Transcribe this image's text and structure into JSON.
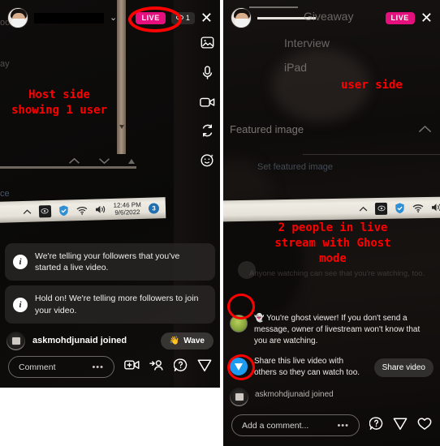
{
  "host_panel": {
    "name": "host-side-live-broadcast",
    "header": {
      "username_redacted": "",
      "chevron_icon": "chevron-down-icon",
      "live_label": "LIVE",
      "viewer_count": "1",
      "eye_icon": "eye-icon",
      "close_icon": "close-icon"
    },
    "rail": [
      {
        "icon": "image-icon"
      },
      {
        "icon": "microphone-icon"
      },
      {
        "icon": "video-camera-icon"
      },
      {
        "icon": "flip-camera-icon"
      },
      {
        "icon": "effects-smiley-icon"
      }
    ],
    "background_text": {
      "line1": "oo",
      "line2": "ay",
      "line3": "ce"
    },
    "taskbar": {
      "chevron_up_icon": "chevron-up-icon",
      "hidden_icons_icon": "tray-app-icon",
      "security_icon": "windows-security-icon",
      "wifi_icon": "wifi-icon",
      "volume_icon": "speaker-icon",
      "time": "12:46 PM",
      "date": "9/6/2022",
      "notification_count": "3"
    },
    "toasts": [
      {
        "icon": "info-icon",
        "text": "We're telling your followers that you've started a live video."
      },
      {
        "icon": "info-icon",
        "text": "Hold on! We're telling more followers to join your video."
      }
    ],
    "join_event": {
      "avatar_icon": "user-avatar",
      "text": "askmohdjunaid joined",
      "wave_emoji": "👋",
      "wave_label": "Wave"
    },
    "comment_bar": {
      "placeholder": "Comment",
      "more_icon": "ellipsis-icon",
      "icons": [
        {
          "icon": "add-video-icon"
        },
        {
          "icon": "invite-person-icon"
        },
        {
          "icon": "question-icon"
        },
        {
          "icon": "send-icon"
        }
      ]
    },
    "annotation": {
      "line1": "Host side",
      "line2": "showing 1 user"
    }
  },
  "user_panel": {
    "name": "viewer-side-live-broadcast",
    "header": {
      "username_redacted": "",
      "check_icon": "check-icon",
      "live_label": "LIVE",
      "close_icon": "close-icon"
    },
    "background_text": {
      "item1": "Giveaway",
      "item2": "Interview",
      "item3": "iPad",
      "featured_image": "Featured image",
      "featured_chevron_icon": "chevron-up-icon",
      "set_featured_image": "Set featured image",
      "faint_comment": "Anyone watching can see that you're watching, too."
    },
    "taskbar": {
      "chevron_up_icon": "chevron-up-icon",
      "hidden_icons_icon": "tray-app-icon",
      "security_icon": "windows-security-icon",
      "wifi_icon": "wifi-icon",
      "volume_icon": "speaker-icon"
    },
    "messages": [
      {
        "avatar_icon": "ghost-viewer-avatar",
        "emoji": "👻",
        "text": "You're ghost viewer! If you don't send a message, owner of livestream won't know that you are watching.",
        "circled": true
      },
      {
        "avatar_icon": "share-send-icon",
        "text": "Share this live video with others so they can watch too.",
        "button": "Share video",
        "circled": false
      },
      {
        "avatar_icon": "user-avatar",
        "text": "askmohdjunaid joined",
        "circled": true
      }
    ],
    "comment_bar": {
      "placeholder": "Add a comment...",
      "more_icon": "ellipsis-icon",
      "icons": [
        {
          "icon": "question-icon"
        },
        {
          "icon": "send-icon"
        },
        {
          "icon": "heart-icon"
        }
      ]
    },
    "annotation": {
      "label": "user side",
      "line1": "2 people in live",
      "line2": "stream with Ghost",
      "line3": "mode"
    }
  },
  "colors": {
    "live_badge": "#e5107e",
    "annotation_red": "#fe0000",
    "accent_blue": "#1e9bf0"
  }
}
